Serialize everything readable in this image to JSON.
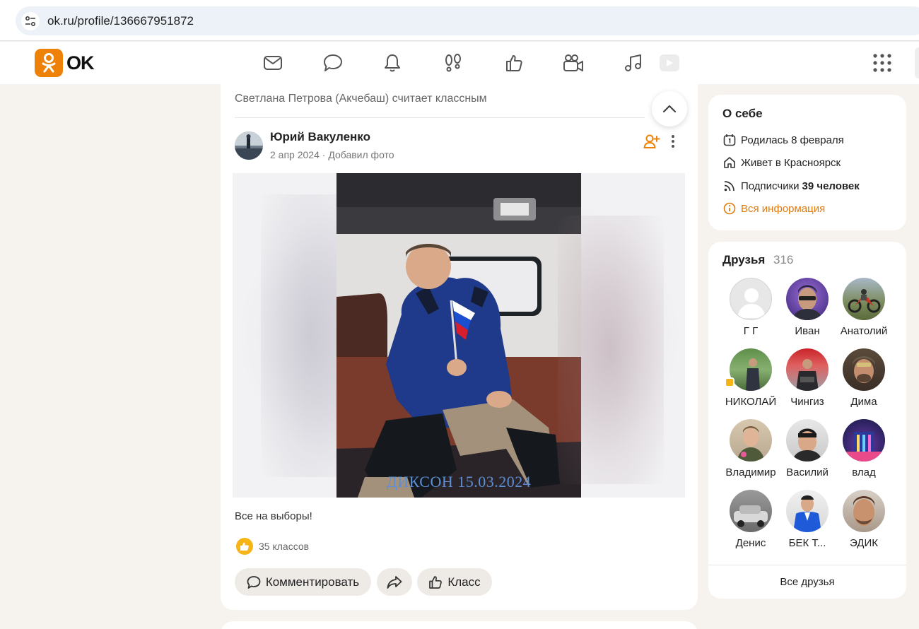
{
  "browser": {
    "url": "ok.ru/profile/136667951872"
  },
  "header": {
    "logo_text": "OK",
    "nav_icons": [
      "mail-icon",
      "chat-icon",
      "bell-icon",
      "footprints-icon",
      "like-icon",
      "video-camera-icon",
      "music-icon",
      "video-play-icon"
    ],
    "apps_icon": "grid-icon"
  },
  "post": {
    "activity": "Светлана Петрова (Акчебаш) считает классным",
    "author": "Юрий Вакуленко",
    "date": "2 апр 2024",
    "meta_separator": "·",
    "action": "Добавил фото",
    "photo_caption": "ДИКСОН 15.03.2024",
    "text": "Все на выборы!",
    "likes": "35 классов",
    "buttons": {
      "comment": "Комментировать",
      "like": "Класс"
    },
    "accent_color": "#ee8208",
    "like_badge_color": "#f6b416"
  },
  "about": {
    "title": "О себе",
    "birthday": "Родилась 8 февраля",
    "city": "Живет в Красноярск",
    "subscribers_label": "Подписчики",
    "subscribers_value": "39 человек",
    "all_info": "Вся информация"
  },
  "friends": {
    "title": "Друзья",
    "count": "316",
    "items": [
      {
        "name": "Г Г"
      },
      {
        "name": "Иван"
      },
      {
        "name": "Анатолий"
      },
      {
        "name": "НИКОЛАЙ"
      },
      {
        "name": "Чингиз"
      },
      {
        "name": "Дима"
      },
      {
        "name": "Владимир"
      },
      {
        "name": "Василий"
      },
      {
        "name": "влад"
      },
      {
        "name": "Денис"
      },
      {
        "name": "БЕК Т..."
      },
      {
        "name": "ЭДИК"
      }
    ],
    "all_label": "Все друзья"
  }
}
